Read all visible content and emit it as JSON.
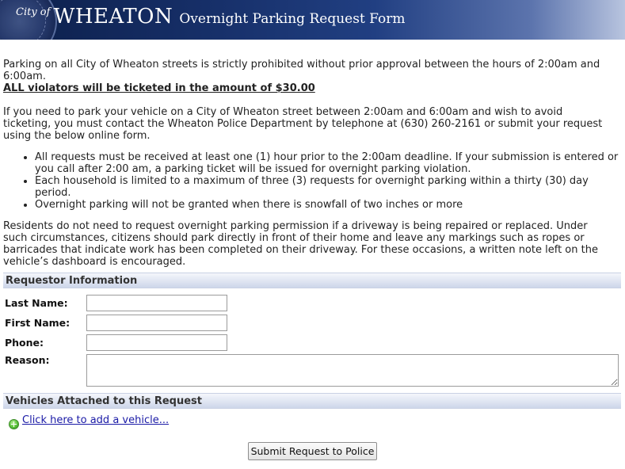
{
  "header": {
    "city_of": "City of",
    "city_name": "WHEATON",
    "form_title": "Overnight Parking Request Form"
  },
  "intro": {
    "prohibition": "Parking on all City of Wheaton streets is strictly prohibited without prior approval between the hours of 2:00am and 6:00am.",
    "violators": "ALL violators will be ticketed in the amount of $30.00",
    "contact": "If you need to park your vehicle on a City of Wheaton street between 2:00am and 6:00am and wish to avoid ticketing, you must contact the Wheaton Police Department by telephone at (630) 260-2161 or submit your request using the below online form."
  },
  "rules": [
    "All requests must be received at least one (1) hour prior to the 2:00am deadline. If your submission is entered or you call after 2:00 am, a parking ticket will be issued for overnight parking violation.",
    "Each household is limited to a maximum of three (3) requests for overnight parking within a thirty (30) day period.",
    "Overnight parking will not be granted when there is snowfall of two inches or more"
  ],
  "driveway_note": "Residents do not need to request overnight parking permission if a driveway is being repaired or replaced. Under such circumstances, citizens should park directly in front of their home and leave any markings such as ropes or barricades that indicate work has been completed on their driveway. For these occasions, a written note left on the vehicle’s dashboard is encouraged.",
  "requestor": {
    "section_title": "Requestor Information",
    "last_name_label": "Last Name:",
    "last_name_value": "",
    "first_name_label": "First Name:",
    "first_name_value": "",
    "phone_label": "Phone:",
    "phone_value": "",
    "reason_label": "Reason:",
    "reason_value": ""
  },
  "vehicles": {
    "section_title": "Vehicles Attached to this Request",
    "add_link": "Click here to add a vehicle...",
    "add_icon": "plus-circle-icon"
  },
  "submit_label": "Submit Request to Police",
  "colors": {
    "banner_dark": "#0c1f4a",
    "banner_light": "#b8c4df",
    "section_band": "#dfe5f2",
    "link": "#1a1aa6",
    "add_icon_green": "#5ac23a"
  }
}
